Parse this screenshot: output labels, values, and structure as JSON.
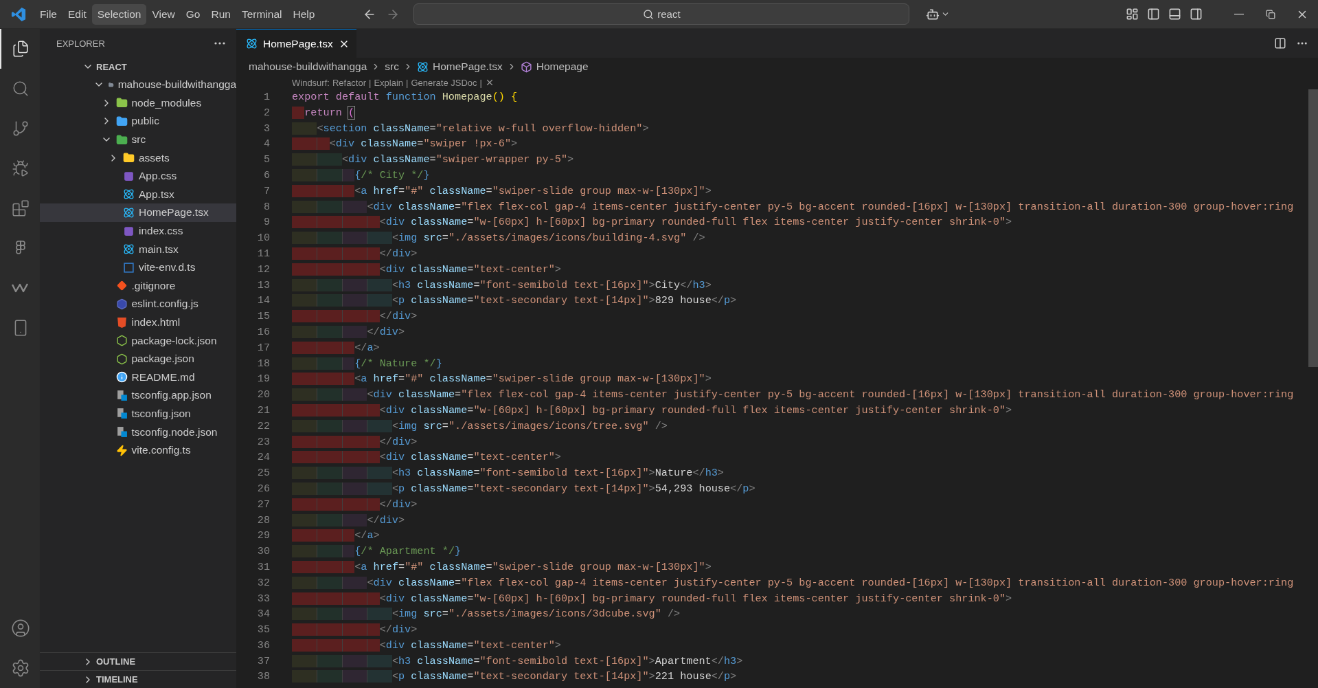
{
  "title_bar": {
    "menu": [
      {
        "label": "File",
        "selected": false
      },
      {
        "label": "Edit",
        "selected": false
      },
      {
        "label": "Selection",
        "selected": true
      },
      {
        "label": "View",
        "selected": false
      },
      {
        "label": "Go",
        "selected": false
      },
      {
        "label": "Run",
        "selected": false
      },
      {
        "label": "Terminal",
        "selected": false
      },
      {
        "label": "Help",
        "selected": false
      }
    ],
    "search": {
      "value": "react"
    }
  },
  "activity_bar": {
    "items": [
      {
        "selected": true
      },
      {
        "selected": false
      },
      {
        "selected": false
      },
      {
        "selected": false
      },
      {
        "selected": false
      },
      {
        "selected": false
      },
      {
        "selected": false
      },
      {
        "selected": false
      }
    ]
  },
  "explorer": {
    "title": "EXPLORER",
    "workspace": {
      "label": "REACT",
      "expanded": true
    },
    "tree": [
      {
        "label": "mahouse-buildwithangga",
        "kind": "folder",
        "expanded": true,
        "selected": false,
        "children": [
          {
            "label": "node_modules",
            "kind": "foldernode",
            "expanded": false,
            "selected": false
          },
          {
            "label": "public",
            "kind": "folderpublic",
            "expanded": false,
            "selected": false
          },
          {
            "label": "src",
            "kind": "foldersrc",
            "expanded": true,
            "selected": false,
            "children": [
              {
                "label": "assets",
                "kind": "folderassets",
                "expanded": false,
                "selected": false
              },
              {
                "label": "App.css",
                "kind": "css",
                "selected": false
              },
              {
                "label": "App.tsx",
                "kind": "react",
                "selected": false
              },
              {
                "label": "HomePage.tsx",
                "kind": "react",
                "selected": true
              },
              {
                "label": "index.css",
                "kind": "css",
                "selected": false
              },
              {
                "label": "main.tsx",
                "kind": "react",
                "selected": false
              },
              {
                "label": "vite-env.d.ts",
                "kind": "ts",
                "selected": false
              }
            ]
          },
          {
            "label": ".gitignore",
            "kind": "git",
            "selected": false
          },
          {
            "label": "eslint.config.js",
            "kind": "eslint",
            "selected": false
          },
          {
            "label": "index.html",
            "kind": "html",
            "selected": false
          },
          {
            "label": "package-lock.json",
            "kind": "json",
            "selected": false
          },
          {
            "label": "package.json",
            "kind": "json",
            "selected": false
          },
          {
            "label": "README.md",
            "kind": "info",
            "selected": false
          },
          {
            "label": "tsconfig.app.json",
            "kind": "tsconfig",
            "selected": false
          },
          {
            "label": "tsconfig.json",
            "kind": "tsconfig",
            "selected": false
          },
          {
            "label": "tsconfig.node.json",
            "kind": "tsconfig",
            "selected": false
          },
          {
            "label": "vite.config.ts",
            "kind": "vite",
            "selected": false
          }
        ]
      }
    ],
    "panels": [
      {
        "label": "OUTLINE",
        "expanded": false
      },
      {
        "label": "TIMELINE",
        "expanded": false
      }
    ]
  },
  "editor": {
    "tabs": [
      {
        "label": "HomePage.tsx",
        "kind": "react",
        "selected": true
      }
    ],
    "breadcrumb": [
      {
        "label": "mahouse-buildwithangga",
        "kind": "folder"
      },
      {
        "label": "src",
        "kind": "folder"
      },
      {
        "label": "HomePage.tsx",
        "kind": "react"
      },
      {
        "label": "Homepage",
        "kind": "symbol"
      }
    ],
    "codelens": {
      "prefix": "Windsurf:",
      "actions": [
        "Refactor",
        "Explain",
        "Generate JSDoc"
      ],
      "separator": "|"
    },
    "lines": [
      {
        "number": "1",
        "tokens": [
          {
            "kind": "kw",
            "text": "export default "
          },
          {
            "kind": "storage",
            "text": "function "
          },
          {
            "kind": "fn",
            "text": "Homepage"
          },
          {
            "kind": "brace",
            "text": "() {"
          }
        ]
      },
      {
        "number": "2",
        "indent_error": true,
        "tokens": [
          {
            "kind": "kw",
            "text": "  return "
          },
          {
            "kind": "paren",
            "text": "("
          }
        ]
      },
      {
        "number": "3",
        "indent_error": false,
        "tokens": [
          {
            "kind": "tagp",
            "text": "    <"
          },
          {
            "kind": "tag",
            "text": "section"
          },
          {
            "kind": "attr",
            "text": " className"
          },
          {
            "kind": "op",
            "text": "="
          },
          {
            "kind": "str",
            "text": "\"relative w-full overflow-hidden\""
          },
          {
            "kind": "tagp",
            "text": ">"
          }
        ]
      },
      {
        "number": "4",
        "indent_error": true,
        "tokens": [
          {
            "kind": "tagp",
            "text": "      <"
          },
          {
            "kind": "tag",
            "text": "div"
          },
          {
            "kind": "attr",
            "text": " className"
          },
          {
            "kind": "op",
            "text": "="
          },
          {
            "kind": "str",
            "text": "\"swiper !px-6\""
          },
          {
            "kind": "tagp",
            "text": ">"
          }
        ]
      },
      {
        "number": "5",
        "indent_error": false,
        "tokens": [
          {
            "kind": "tagp",
            "text": "        <"
          },
          {
            "kind": "tag",
            "text": "div"
          },
          {
            "kind": "attr",
            "text": " className"
          },
          {
            "kind": "op",
            "text": "="
          },
          {
            "kind": "str",
            "text": "\"swiper-wrapper py-5\""
          },
          {
            "kind": "tagp",
            "text": ">"
          }
        ]
      },
      {
        "number": "6",
        "indent_error": false,
        "tokens": [
          {
            "kind": "jsx",
            "text": "          {"
          },
          {
            "kind": "cmt",
            "text": "/* City */"
          },
          {
            "kind": "jsx",
            "text": "}"
          }
        ]
      },
      {
        "number": "7",
        "indent_error": true,
        "tokens": [
          {
            "kind": "tagp",
            "text": "          <"
          },
          {
            "kind": "tag",
            "text": "a"
          },
          {
            "kind": "attr",
            "text": " href"
          },
          {
            "kind": "op",
            "text": "="
          },
          {
            "kind": "str",
            "text": "\"#\""
          },
          {
            "kind": "attr",
            "text": " className"
          },
          {
            "kind": "op",
            "text": "="
          },
          {
            "kind": "str",
            "text": "\"swiper-slide group max-w-[130px]\""
          },
          {
            "kind": "tagp",
            "text": ">"
          }
        ]
      },
      {
        "number": "8",
        "indent_error": false,
        "tokens": [
          {
            "kind": "tagp",
            "text": "            <"
          },
          {
            "kind": "tag",
            "text": "div"
          },
          {
            "kind": "attr",
            "text": " className"
          },
          {
            "kind": "op",
            "text": "="
          },
          {
            "kind": "str",
            "text": "\"flex flex-col gap-4 items-center justify-center py-5 bg-accent rounded-[16px] w-[130px] transition-all duration-300 group-hover:ring"
          }
        ]
      },
      {
        "number": "9",
        "indent_error": true,
        "tokens": [
          {
            "kind": "tagp",
            "text": "              <"
          },
          {
            "kind": "tag",
            "text": "div"
          },
          {
            "kind": "attr",
            "text": " className"
          },
          {
            "kind": "op",
            "text": "="
          },
          {
            "kind": "str",
            "text": "\"w-[60px] h-[60px] bg-primary rounded-full flex items-center justify-center shrink-0\""
          },
          {
            "kind": "tagp",
            "text": ">"
          }
        ]
      },
      {
        "number": "10",
        "indent_error": false,
        "tokens": [
          {
            "kind": "tagp",
            "text": "                <"
          },
          {
            "kind": "tag",
            "text": "img"
          },
          {
            "kind": "attr",
            "text": " src"
          },
          {
            "kind": "op",
            "text": "="
          },
          {
            "kind": "str",
            "text": "\"./assets/images/icons/building-4.svg\""
          },
          {
            "kind": "tagp",
            "text": " />"
          }
        ]
      },
      {
        "number": "11",
        "indent_error": true,
        "tokens": [
          {
            "kind": "tagp",
            "text": "              </"
          },
          {
            "kind": "tag",
            "text": "div"
          },
          {
            "kind": "tagp",
            "text": ">"
          }
        ]
      },
      {
        "number": "12",
        "indent_error": true,
        "tokens": [
          {
            "kind": "tagp",
            "text": "              <"
          },
          {
            "kind": "tag",
            "text": "div"
          },
          {
            "kind": "attr",
            "text": " className"
          },
          {
            "kind": "op",
            "text": "="
          },
          {
            "kind": "str",
            "text": "\"text-center\""
          },
          {
            "kind": "tagp",
            "text": ">"
          }
        ]
      },
      {
        "number": "13",
        "indent_error": false,
        "tokens": [
          {
            "kind": "tagp",
            "text": "                <"
          },
          {
            "kind": "tag",
            "text": "h3"
          },
          {
            "kind": "attr",
            "text": " className"
          },
          {
            "kind": "op",
            "text": "="
          },
          {
            "kind": "str",
            "text": "\"font-semibold text-[16px]\""
          },
          {
            "kind": "tagp",
            "text": ">"
          },
          {
            "kind": "text",
            "text": "City"
          },
          {
            "kind": "tagp",
            "text": "</"
          },
          {
            "kind": "tag",
            "text": "h3"
          },
          {
            "kind": "tagp",
            "text": ">"
          }
        ]
      },
      {
        "number": "14",
        "indent_error": false,
        "tokens": [
          {
            "kind": "tagp",
            "text": "                <"
          },
          {
            "kind": "tag",
            "text": "p"
          },
          {
            "kind": "attr",
            "text": " className"
          },
          {
            "kind": "op",
            "text": "="
          },
          {
            "kind": "str",
            "text": "\"text-secondary text-[14px]\""
          },
          {
            "kind": "tagp",
            "text": ">"
          },
          {
            "kind": "text",
            "text": "829 house"
          },
          {
            "kind": "tagp",
            "text": "</"
          },
          {
            "kind": "tag",
            "text": "p"
          },
          {
            "kind": "tagp",
            "text": ">"
          }
        ]
      },
      {
        "number": "15",
        "indent_error": true,
        "tokens": [
          {
            "kind": "tagp",
            "text": "              </"
          },
          {
            "kind": "tag",
            "text": "div"
          },
          {
            "kind": "tagp",
            "text": ">"
          }
        ]
      },
      {
        "number": "16",
        "indent_error": false,
        "tokens": [
          {
            "kind": "tagp",
            "text": "            </"
          },
          {
            "kind": "tag",
            "text": "div"
          },
          {
            "kind": "tagp",
            "text": ">"
          }
        ]
      },
      {
        "number": "17",
        "indent_error": true,
        "tokens": [
          {
            "kind": "tagp",
            "text": "          </"
          },
          {
            "kind": "tag",
            "text": "a"
          },
          {
            "kind": "tagp",
            "text": ">"
          }
        ]
      },
      {
        "number": "18",
        "indent_error": false,
        "tokens": [
          {
            "kind": "jsx",
            "text": "          {"
          },
          {
            "kind": "cmt",
            "text": "/* Nature */"
          },
          {
            "kind": "jsx",
            "text": "}"
          }
        ]
      },
      {
        "number": "19",
        "indent_error": true,
        "tokens": [
          {
            "kind": "tagp",
            "text": "          <"
          },
          {
            "kind": "tag",
            "text": "a"
          },
          {
            "kind": "attr",
            "text": " href"
          },
          {
            "kind": "op",
            "text": "="
          },
          {
            "kind": "str",
            "text": "\"#\""
          },
          {
            "kind": "attr",
            "text": " className"
          },
          {
            "kind": "op",
            "text": "="
          },
          {
            "kind": "str",
            "text": "\"swiper-slide group max-w-[130px]\""
          },
          {
            "kind": "tagp",
            "text": ">"
          }
        ]
      },
      {
        "number": "20",
        "indent_error": false,
        "tokens": [
          {
            "kind": "tagp",
            "text": "            <"
          },
          {
            "kind": "tag",
            "text": "div"
          },
          {
            "kind": "attr",
            "text": " className"
          },
          {
            "kind": "op",
            "text": "="
          },
          {
            "kind": "str",
            "text": "\"flex flex-col gap-4 items-center justify-center py-5 bg-accent rounded-[16px] w-[130px] transition-all duration-300 group-hover:ring"
          }
        ]
      },
      {
        "number": "21",
        "indent_error": true,
        "tokens": [
          {
            "kind": "tagp",
            "text": "              <"
          },
          {
            "kind": "tag",
            "text": "div"
          },
          {
            "kind": "attr",
            "text": " className"
          },
          {
            "kind": "op",
            "text": "="
          },
          {
            "kind": "str",
            "text": "\"w-[60px] h-[60px] bg-primary rounded-full flex items-center justify-center shrink-0\""
          },
          {
            "kind": "tagp",
            "text": ">"
          }
        ]
      },
      {
        "number": "22",
        "indent_error": false,
        "tokens": [
          {
            "kind": "tagp",
            "text": "                <"
          },
          {
            "kind": "tag",
            "text": "img"
          },
          {
            "kind": "attr",
            "text": " src"
          },
          {
            "kind": "op",
            "text": "="
          },
          {
            "kind": "str",
            "text": "\"./assets/images/icons/tree.svg\""
          },
          {
            "kind": "tagp",
            "text": " />"
          }
        ]
      },
      {
        "number": "23",
        "indent_error": true,
        "tokens": [
          {
            "kind": "tagp",
            "text": "              </"
          },
          {
            "kind": "tag",
            "text": "div"
          },
          {
            "kind": "tagp",
            "text": ">"
          }
        ]
      },
      {
        "number": "24",
        "indent_error": true,
        "tokens": [
          {
            "kind": "tagp",
            "text": "              <"
          },
          {
            "kind": "tag",
            "text": "div"
          },
          {
            "kind": "attr",
            "text": " className"
          },
          {
            "kind": "op",
            "text": "="
          },
          {
            "kind": "str",
            "text": "\"text-center\""
          },
          {
            "kind": "tagp",
            "text": ">"
          }
        ]
      },
      {
        "number": "25",
        "indent_error": false,
        "tokens": [
          {
            "kind": "tagp",
            "text": "                <"
          },
          {
            "kind": "tag",
            "text": "h3"
          },
          {
            "kind": "attr",
            "text": " className"
          },
          {
            "kind": "op",
            "text": "="
          },
          {
            "kind": "str",
            "text": "\"font-semibold text-[16px]\""
          },
          {
            "kind": "tagp",
            "text": ">"
          },
          {
            "kind": "text",
            "text": "Nature"
          },
          {
            "kind": "tagp",
            "text": "</"
          },
          {
            "kind": "tag",
            "text": "h3"
          },
          {
            "kind": "tagp",
            "text": ">"
          }
        ]
      },
      {
        "number": "26",
        "indent_error": false,
        "tokens": [
          {
            "kind": "tagp",
            "text": "                <"
          },
          {
            "kind": "tag",
            "text": "p"
          },
          {
            "kind": "attr",
            "text": " className"
          },
          {
            "kind": "op",
            "text": "="
          },
          {
            "kind": "str",
            "text": "\"text-secondary text-[14px]\""
          },
          {
            "kind": "tagp",
            "text": ">"
          },
          {
            "kind": "text",
            "text": "54,293 house"
          },
          {
            "kind": "tagp",
            "text": "</"
          },
          {
            "kind": "tag",
            "text": "p"
          },
          {
            "kind": "tagp",
            "text": ">"
          }
        ]
      },
      {
        "number": "27",
        "indent_error": true,
        "tokens": [
          {
            "kind": "tagp",
            "text": "              </"
          },
          {
            "kind": "tag",
            "text": "div"
          },
          {
            "kind": "tagp",
            "text": ">"
          }
        ]
      },
      {
        "number": "28",
        "indent_error": false,
        "tokens": [
          {
            "kind": "tagp",
            "text": "            </"
          },
          {
            "kind": "tag",
            "text": "div"
          },
          {
            "kind": "tagp",
            "text": ">"
          }
        ]
      },
      {
        "number": "29",
        "indent_error": true,
        "tokens": [
          {
            "kind": "tagp",
            "text": "          </"
          },
          {
            "kind": "tag",
            "text": "a"
          },
          {
            "kind": "tagp",
            "text": ">"
          }
        ]
      },
      {
        "number": "30",
        "indent_error": false,
        "tokens": [
          {
            "kind": "jsx",
            "text": "          {"
          },
          {
            "kind": "cmt",
            "text": "/* Apartment */"
          },
          {
            "kind": "jsx",
            "text": "}"
          }
        ]
      },
      {
        "number": "31",
        "indent_error": true,
        "tokens": [
          {
            "kind": "tagp",
            "text": "          <"
          },
          {
            "kind": "tag",
            "text": "a"
          },
          {
            "kind": "attr",
            "text": " href"
          },
          {
            "kind": "op",
            "text": "="
          },
          {
            "kind": "str",
            "text": "\"#\""
          },
          {
            "kind": "attr",
            "text": " className"
          },
          {
            "kind": "op",
            "text": "="
          },
          {
            "kind": "str",
            "text": "\"swiper-slide group max-w-[130px]\""
          },
          {
            "kind": "tagp",
            "text": ">"
          }
        ]
      },
      {
        "number": "32",
        "indent_error": false,
        "tokens": [
          {
            "kind": "tagp",
            "text": "            <"
          },
          {
            "kind": "tag",
            "text": "div"
          },
          {
            "kind": "attr",
            "text": " className"
          },
          {
            "kind": "op",
            "text": "="
          },
          {
            "kind": "str",
            "text": "\"flex flex-col gap-4 items-center justify-center py-5 bg-accent rounded-[16px] w-[130px] transition-all duration-300 group-hover:ring"
          }
        ]
      },
      {
        "number": "33",
        "indent_error": true,
        "tokens": [
          {
            "kind": "tagp",
            "text": "              <"
          },
          {
            "kind": "tag",
            "text": "div"
          },
          {
            "kind": "attr",
            "text": " className"
          },
          {
            "kind": "op",
            "text": "="
          },
          {
            "kind": "str",
            "text": "\"w-[60px] h-[60px] bg-primary rounded-full flex items-center justify-center shrink-0\""
          },
          {
            "kind": "tagp",
            "text": ">"
          }
        ]
      },
      {
        "number": "34",
        "indent_error": false,
        "tokens": [
          {
            "kind": "tagp",
            "text": "                <"
          },
          {
            "kind": "tag",
            "text": "img"
          },
          {
            "kind": "attr",
            "text": " src"
          },
          {
            "kind": "op",
            "text": "="
          },
          {
            "kind": "str",
            "text": "\"./assets/images/icons/3dcube.svg\""
          },
          {
            "kind": "tagp",
            "text": " />"
          }
        ]
      },
      {
        "number": "35",
        "indent_error": true,
        "tokens": [
          {
            "kind": "tagp",
            "text": "              </"
          },
          {
            "kind": "tag",
            "text": "div"
          },
          {
            "kind": "tagp",
            "text": ">"
          }
        ]
      },
      {
        "number": "36",
        "indent_error": true,
        "tokens": [
          {
            "kind": "tagp",
            "text": "              <"
          },
          {
            "kind": "tag",
            "text": "div"
          },
          {
            "kind": "attr",
            "text": " className"
          },
          {
            "kind": "op",
            "text": "="
          },
          {
            "kind": "str",
            "text": "\"text-center\""
          },
          {
            "kind": "tagp",
            "text": ">"
          }
        ]
      },
      {
        "number": "37",
        "indent_error": false,
        "tokens": [
          {
            "kind": "tagp",
            "text": "                <"
          },
          {
            "kind": "tag",
            "text": "h3"
          },
          {
            "kind": "attr",
            "text": " className"
          },
          {
            "kind": "op",
            "text": "="
          },
          {
            "kind": "str",
            "text": "\"font-semibold text-[16px]\""
          },
          {
            "kind": "tagp",
            "text": ">"
          },
          {
            "kind": "text",
            "text": "Apartment"
          },
          {
            "kind": "tagp",
            "text": "</"
          },
          {
            "kind": "tag",
            "text": "h3"
          },
          {
            "kind": "tagp",
            "text": ">"
          }
        ]
      },
      {
        "number": "38",
        "indent_error": false,
        "tokens": [
          {
            "kind": "tagp",
            "text": "                <"
          },
          {
            "kind": "tag",
            "text": "p"
          },
          {
            "kind": "attr",
            "text": " className"
          },
          {
            "kind": "op",
            "text": "="
          },
          {
            "kind": "str",
            "text": "\"text-secondary text-[14px]\""
          },
          {
            "kind": "tagp",
            "text": ">"
          },
          {
            "kind": "text",
            "text": "221 house"
          },
          {
            "kind": "tagp",
            "text": "</"
          },
          {
            "kind": "tag",
            "text": "p"
          },
          {
            "kind": "tagp",
            "text": ">"
          }
        ]
      }
    ]
  }
}
